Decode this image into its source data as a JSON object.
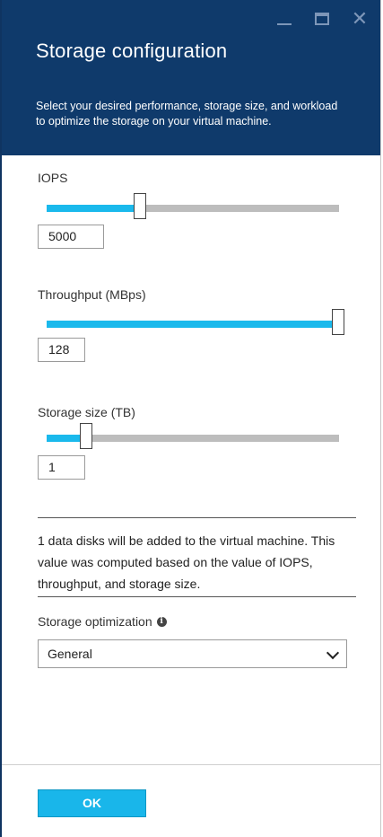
{
  "header": {
    "title": "Storage configuration",
    "subtitle": "Select your desired performance, storage size, and workload to optimize the storage on your virtual machine.",
    "controls": {
      "minimize": "minimize-icon",
      "maximize": "maximize-icon",
      "close": "close-icon"
    },
    "bg_color": "#0f3a6b"
  },
  "iops": {
    "label": "IOPS",
    "value": "5000",
    "slider_fraction": 0.31
  },
  "throughput": {
    "label": "Throughput (MBps)",
    "value": "128",
    "slider_fraction": 1.0
  },
  "storage": {
    "label": "Storage size (TB)",
    "value": "1",
    "slider_fraction": 0.12
  },
  "info": {
    "text": "1 data disks will be added to the virtual machine. This value was computed based on the value of IOPS, throughput, and storage size."
  },
  "optimization": {
    "label": "Storage optimization",
    "info_icon": "info-icon",
    "selected": "General"
  },
  "footer": {
    "ok_label": "OK"
  },
  "colors": {
    "accent": "#1ab9ec",
    "track": "#bdbdbd"
  }
}
